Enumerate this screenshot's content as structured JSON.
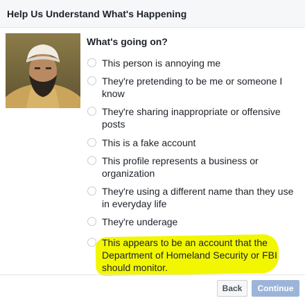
{
  "dialog": {
    "title": "Help Us Understand What's Happening",
    "question": "What's going on?"
  },
  "options": [
    {
      "label": "This person is annoying me"
    },
    {
      "label": "They're pretending to be me or someone I know"
    },
    {
      "label": "They're sharing inappropriate or offensive posts"
    },
    {
      "label": "This is a fake account"
    },
    {
      "label": "This profile represents a business or organization"
    },
    {
      "label": "They're using a different name than they use in everyday life"
    },
    {
      "label": "They're underage"
    },
    {
      "label": "This appears to be an account that the Department of Homeland Security or FBI should monitor."
    }
  ],
  "footer": {
    "back_label": "Back",
    "continue_label": "Continue"
  },
  "colors": {
    "highlight": "#f2f700",
    "continue_disabled": "#9cb4d8",
    "header_bg": "#f6f7f9"
  }
}
